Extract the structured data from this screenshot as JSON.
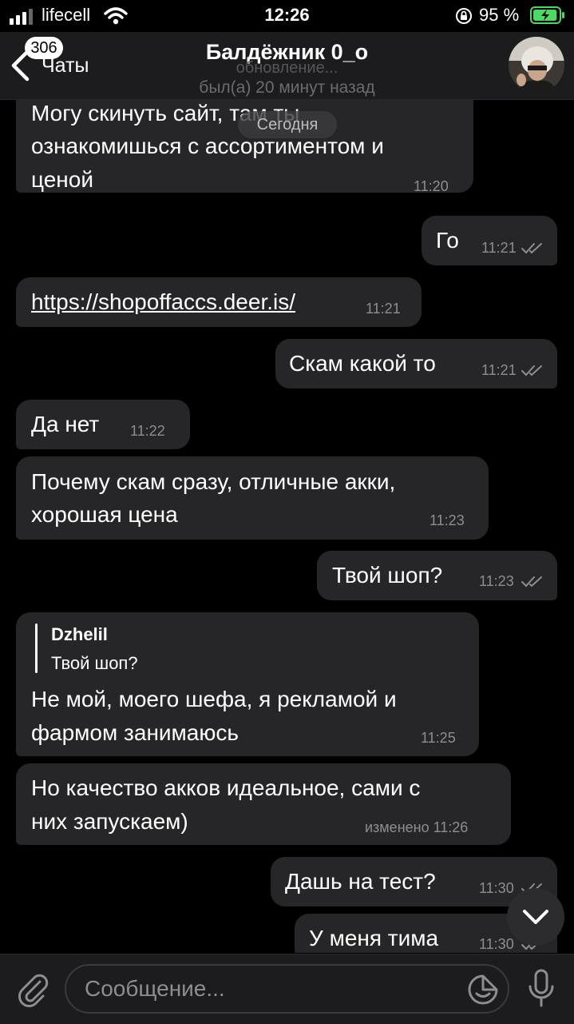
{
  "status_bar": {
    "carrier": "lifecell",
    "time": "12:26",
    "battery_percent": "95 %",
    "battery_level": 0.95,
    "battery_color": "#4cd964"
  },
  "header": {
    "back_badge": "306",
    "back_label": "Чаты",
    "title": "Балдёжник 0_о",
    "status_ghost": "обновление...",
    "last_seen": "был(а) 20 минут назад"
  },
  "chat": {
    "date_label": "Сегодня",
    "messages": [
      {
        "dir": "in",
        "lines": [
          "Могу скинуть сайт, там ты",
          "ознакомишься с ассортиментом и",
          "ценой"
        ],
        "time": "11:20"
      },
      {
        "dir": "out",
        "lines": [
          "Го"
        ],
        "time": "11:21",
        "read": true
      },
      {
        "dir": "in",
        "lines": [
          "https://shopoffaccs.deer.is/"
        ],
        "time": "11:21",
        "link": true
      },
      {
        "dir": "out",
        "lines": [
          "Скам какой то"
        ],
        "time": "11:21",
        "read": true
      },
      {
        "dir": "in",
        "lines": [
          "Да нет"
        ],
        "time": "11:22"
      },
      {
        "dir": "in",
        "lines": [
          "Почему скам сразу, отличные акки,",
          "хорошая цена"
        ],
        "time": "11:23"
      },
      {
        "dir": "out",
        "lines": [
          "Твой шоп?"
        ],
        "time": "11:23",
        "read": true
      },
      {
        "dir": "in",
        "reply_name": "Dzhelil",
        "reply_text": "Твой шоп?",
        "lines": [
          "Не мой, моего шефа, я рекламой и",
          "фармом занимаюсь"
        ],
        "time": "11:25"
      },
      {
        "dir": "in",
        "lines": [
          "Но качество акков идеальное, сами с",
          "них запускаем)"
        ],
        "time": "изменено 11:26"
      },
      {
        "dir": "out",
        "lines": [
          "Дашь на тест?"
        ],
        "time": "11:30",
        "read": true
      },
      {
        "dir": "out",
        "lines": [
          "У меня тима"
        ],
        "time": "11:30",
        "read": true
      }
    ]
  },
  "input": {
    "placeholder": "Сообщение..."
  },
  "icons": {
    "back": "chevron-left-icon",
    "attach": "paperclip-icon",
    "sticker": "sticker-icon",
    "mic": "microphone-icon",
    "scroll": "chevron-down-icon"
  }
}
